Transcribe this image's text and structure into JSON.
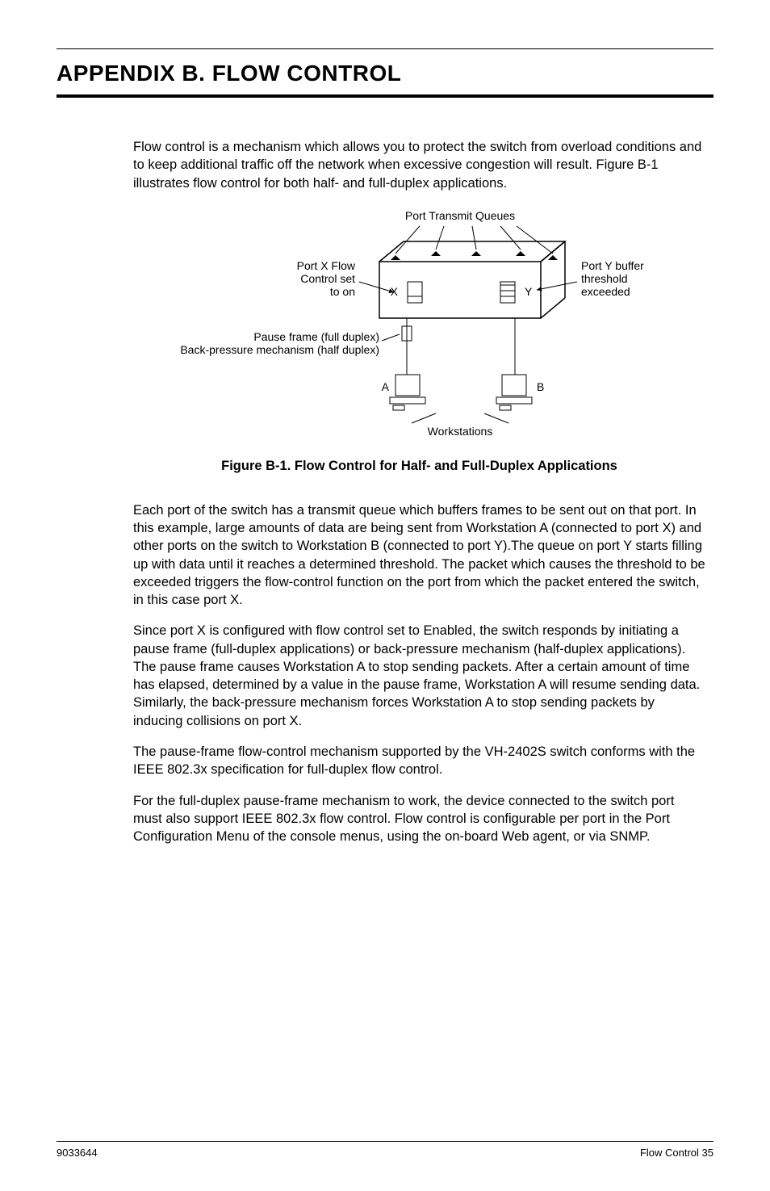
{
  "header": {
    "title": "APPENDIX B.  FLOW CONTROL"
  },
  "paragraphs": {
    "p1": "Flow control is a mechanism which allows you to protect the switch from overload conditions and to keep additional traffic off the network when excessive congestion will result. Figure B-1 illustrates flow control for both half- and full-duplex applications.",
    "p2": "Each port of the switch has a transmit queue which buffers frames to be sent out on that port. In this example, large amounts of data are being sent from Workstation A (connected to port X) and other ports on the switch to Workstation B (connected to port Y).The queue on port Y starts filling up with data until it reaches a determined threshold. The packet which causes the threshold to be exceeded triggers the flow-control function on the port from which the packet entered the switch, in this case port X.",
    "p3": "Since port X is configured with flow control set to Enabled, the switch responds by initiating a pause frame (full-duplex applications) or back-pressure mechanism (half-duplex applications). The pause frame causes Workstation A to stop sending packets. After a certain amount of time has elapsed, determined by a value in the pause frame, Workstation A will resume sending data. Similarly, the back-pressure mechanism forces Workstation A to stop sending packets by inducing collisions on port X.",
    "p4": "The pause-frame flow-control mechanism supported by the VH-2402S switch conforms with the IEEE 802.3x specification for full-duplex flow control.",
    "p5": "For the full-duplex pause-frame mechanism to work, the device connected to the switch port must also support IEEE 802.3x flow control. Flow control is configurable per port in the Port Configuration Menu of the console menus, using the on-board Web agent, or via SNMP."
  },
  "figure": {
    "caption": "Figure B-1. Flow Control for Half- and Full-Duplex Applications",
    "labels": {
      "top": "Port Transmit Queues",
      "left1": "Port X Flow",
      "left2": "Control set",
      "left3": "to on",
      "right1": "Port Y buffer",
      "right2": "threshold",
      "right3": "exceeded",
      "pause1": "Pause frame (full duplex)",
      "pause2": "Back-pressure mechanism (half duplex)",
      "portX": "X",
      "portY": "Y",
      "wsA": "A",
      "wsB": "B",
      "bottom": "Workstations"
    }
  },
  "footer": {
    "left": "9033644",
    "right": "Flow Control  35"
  }
}
